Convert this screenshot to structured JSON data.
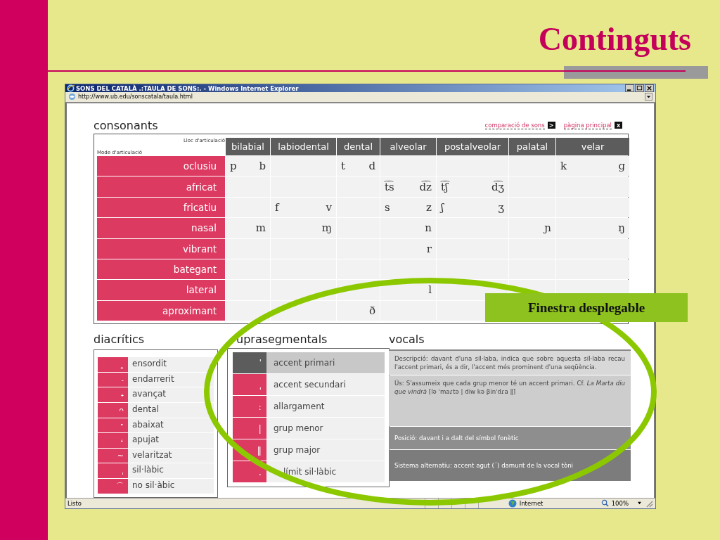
{
  "slide": {
    "title": "Continguts",
    "callout": "Finestra desplegable"
  },
  "browser": {
    "title": "SONS DEL CATALÀ .:TAULA DE SONS:. - Windows Internet Explorer",
    "address": "http://www.ub.edu/sonscatala/taula.html",
    "status": "Listo",
    "zone": "Internet",
    "zoom": "100%"
  },
  "links": [
    {
      "label": "comparació de sons",
      "icon": ">"
    },
    {
      "label": "pàgina principal",
      "icon": "x"
    }
  ],
  "consonants": {
    "title": "consonants",
    "column_header": "Lloc d'articulació",
    "row_header": "Mode d'articulació",
    "columns": [
      "bilabial",
      "labiodental",
      "dental",
      "alveolar",
      "postalveolar",
      "palatal",
      "velar"
    ],
    "rows": [
      {
        "label": "oclusiu",
        "cells": [
          {
            "voiceless": "p",
            "voiced": "b"
          },
          {},
          {
            "voiceless": "t",
            "voiced": "d"
          },
          {},
          {},
          {},
          {
            "voiceless": "k",
            "voiced": "ɡ"
          }
        ]
      },
      {
        "label": "africat",
        "cells": [
          {},
          {},
          {},
          {
            "voiceless": "t͡s",
            "voiced": "d͡z"
          },
          {
            "voiceless": "t͡ʃ",
            "voiced": "d͡ʒ"
          },
          {},
          {}
        ]
      },
      {
        "label": "fricatiu",
        "cells": [
          {},
          {
            "voiceless": "f",
            "voiced": "v"
          },
          {},
          {
            "voiceless": "s",
            "voiced": "z"
          },
          {
            "voiceless": "ʃ",
            "voiced": "ʒ"
          },
          {},
          {}
        ]
      },
      {
        "label": "nasal",
        "cells": [
          {
            "voiced": "m"
          },
          {
            "voiced": "ɱ"
          },
          {},
          {
            "voiced": "n"
          },
          {},
          {
            "voiced": "ɲ"
          },
          {
            "voiced": "ŋ"
          }
        ]
      },
      {
        "label": "vibrant",
        "cells": [
          {},
          {},
          {},
          {
            "voiced": "r"
          },
          {},
          {},
          {}
        ]
      },
      {
        "label": "bategant",
        "cells": [
          {},
          {},
          {},
          {},
          {},
          {},
          {}
        ]
      },
      {
        "label": "lateral",
        "cells": [
          {},
          {},
          {},
          {
            "voiced": "l"
          },
          {},
          {},
          {}
        ]
      },
      {
        "label": "aproximant",
        "cells": [
          {},
          {},
          {
            "voiced": "ð"
          },
          {},
          {},
          {},
          {}
        ]
      }
    ]
  },
  "diacritics": {
    "title": "diacrítics",
    "items": [
      {
        "symbol": "˳",
        "label": "ensordit"
      },
      {
        "symbol": "˗",
        "label": "endarrerit"
      },
      {
        "symbol": "˖",
        "label": "avançat"
      },
      {
        "symbol": "ᴖ",
        "label": "dental"
      },
      {
        "symbol": "˕",
        "label": "abaixat"
      },
      {
        "symbol": "˔",
        "label": "apujat"
      },
      {
        "symbol": "~",
        "label": "velaritzat"
      },
      {
        "symbol": "ˌ",
        "label": "sil·làbic"
      },
      {
        "symbol": "⌒",
        "label": "no sil·àbic"
      }
    ]
  },
  "suprasegmentals": {
    "title": "uprasegmentals",
    "items": [
      {
        "symbol": "ˈ",
        "label": "accent primari",
        "selected": true
      },
      {
        "symbol": "ˌ",
        "label": "accent secundari",
        "selected": false
      },
      {
        "symbol": "ː",
        "label": "allargament",
        "selected": false
      },
      {
        "symbol": "|",
        "label": "grup menor",
        "selected": false
      },
      {
        "symbol": "‖",
        "label": "grup major",
        "selected": false
      },
      {
        "symbol": ".",
        "label": "límit sil·làbic",
        "selected": false
      }
    ]
  },
  "vowels": {
    "title": "vocals",
    "description": "Descripció: davant d'una síl·laba, indica que sobre aquesta síl·laba recau l'accent primari, és a dir, l'accent més prominent d'una seqüència.",
    "usage": "Ús: S'assumeix que cada grup menor té un accent primari. Cf. *La Marta diu que vindrà* [lə ˈmaɾtə | diw kə βinˈdɾa ‖]",
    "position": "Posició: davant i a dalt del símbol fonètic",
    "alternative": "Sistema alternatiu: accent agut (´) damunt de la vocal tòni"
  }
}
